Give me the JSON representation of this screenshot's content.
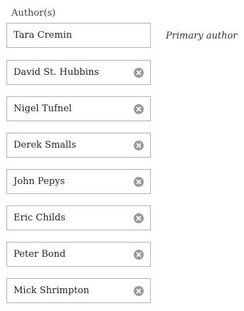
{
  "field": {
    "label": "Author(s)"
  },
  "primary_note": "Primary author",
  "authors": [
    {
      "value": "Tara Cremin",
      "removable": false
    },
    {
      "value": "David St. Hubbins",
      "removable": true
    },
    {
      "value": "Nigel Tufnel",
      "removable": true
    },
    {
      "value": "Derek Smalls",
      "removable": true
    },
    {
      "value": "John Pepys",
      "removable": true
    },
    {
      "value": "Eric Childs",
      "removable": true
    },
    {
      "value": "Peter Bond",
      "removable": true
    },
    {
      "value": "Mick Shrimpton",
      "removable": true
    }
  ],
  "icons": {
    "remove": "remove-circle-x-icon"
  },
  "colors": {
    "border": "#b3b3b3",
    "remove_icon": "#9a9a9a"
  }
}
